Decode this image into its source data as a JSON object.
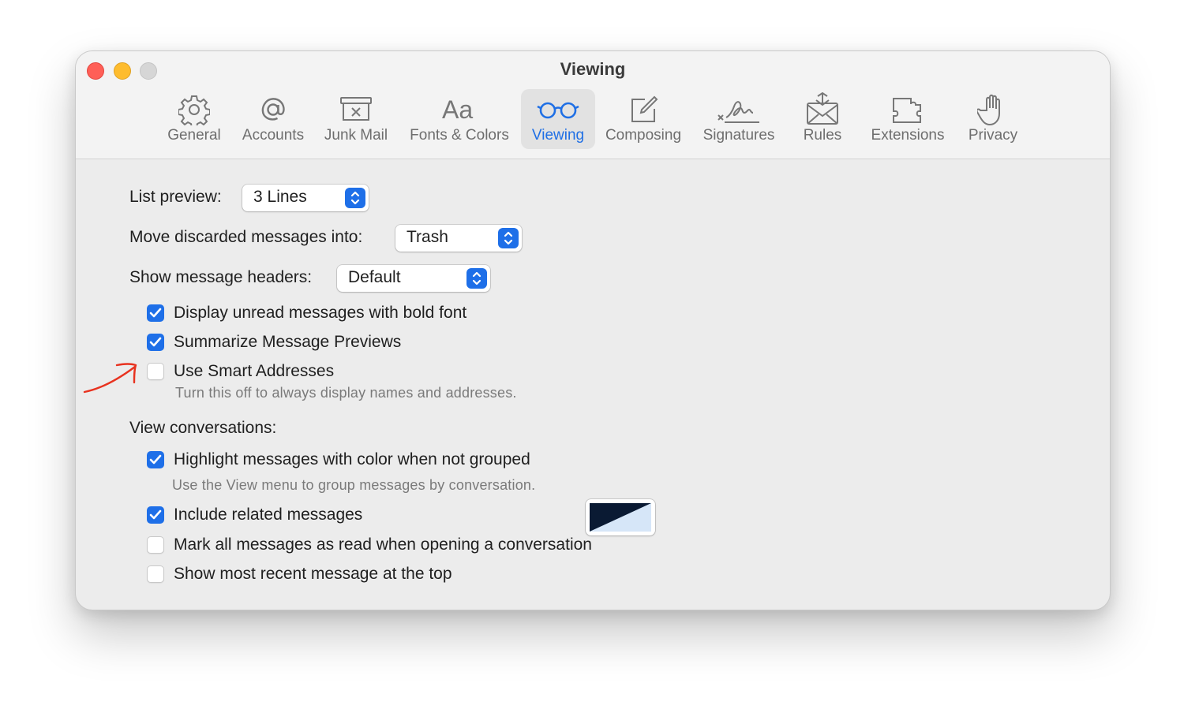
{
  "window": {
    "title": "Viewing"
  },
  "toolbar": {
    "items": [
      {
        "label": "General",
        "icon": "gear-icon"
      },
      {
        "label": "Accounts",
        "icon": "at-icon"
      },
      {
        "label": "Junk Mail",
        "icon": "junk-tray-icon"
      },
      {
        "label": "Fonts & Colors",
        "icon": "font-icon"
      },
      {
        "label": "Viewing",
        "icon": "glasses-icon",
        "active": true
      },
      {
        "label": "Composing",
        "icon": "compose-icon"
      },
      {
        "label": "Signatures",
        "icon": "signature-icon"
      },
      {
        "label": "Rules",
        "icon": "rules-envelope-icon"
      },
      {
        "label": "Extensions",
        "icon": "puzzle-icon"
      },
      {
        "label": "Privacy",
        "icon": "hand-icon"
      }
    ],
    "active_color": "#1f6fe5"
  },
  "settings": {
    "list_preview": {
      "label": "List preview:",
      "value": "3 Lines"
    },
    "move_discarded": {
      "label": "Move discarded messages into:",
      "value": "Trash"
    },
    "message_headers": {
      "label": "Show message headers:",
      "value": "Default"
    },
    "checkboxes": [
      {
        "label": "Display unread messages with bold font",
        "checked": true
      },
      {
        "label": "Summarize Message Previews",
        "checked": true
      },
      {
        "label": "Use Smart Addresses",
        "checked": false,
        "note": "Turn this off to always display names and addresses."
      }
    ]
  },
  "conversations": {
    "heading": "View conversations:",
    "checkboxes": [
      {
        "label": "Highlight messages with color when not grouped",
        "checked": true,
        "note": "Use the View menu to group messages by conversation."
      },
      {
        "label": "Include related messages",
        "checked": true
      },
      {
        "label": "Mark all messages as read when opening a conversation",
        "checked": false
      },
      {
        "label": "Show most recent message at the top",
        "checked": false
      }
    ],
    "highlight_colors": [
      "#0a1a33",
      "#d6e6f8"
    ]
  },
  "help": {
    "label": "?"
  },
  "colors": {
    "accent": "#1e6fe8",
    "annotation_arrow": "#e8321f"
  }
}
